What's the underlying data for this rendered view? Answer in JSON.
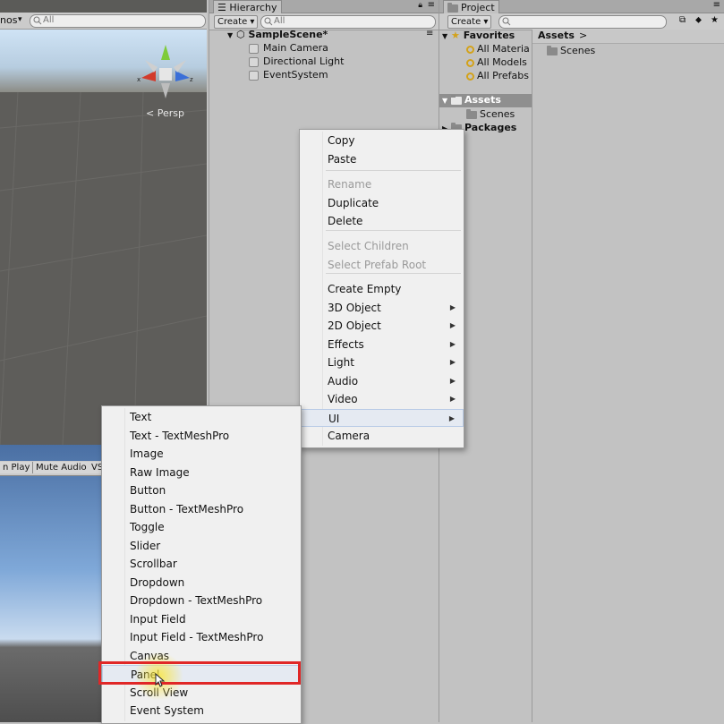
{
  "scene": {
    "gizmos_label": "nos",
    "search_placeholder": "All",
    "persp_label": "Persp",
    "axis_x": "x",
    "axis_z": "z"
  },
  "game": {
    "buttons": [
      "n Play",
      "Mute Audio",
      "VS"
    ]
  },
  "hierarchy": {
    "tab_label": "Hierarchy",
    "create_label": "Create",
    "search_placeholder": "All",
    "scene_name": "SampleScene*",
    "items": [
      "Main Camera",
      "Directional Light",
      "EventSystem"
    ]
  },
  "project": {
    "tab_label": "Project",
    "create_label": "Create",
    "favorites_label": "Favorites",
    "favorites": [
      "All Materia",
      "All Models",
      "All Prefabs"
    ],
    "assets_label": "Assets",
    "assets_children": [
      "Scenes"
    ],
    "packages_label": "Packages",
    "breadcrumb": "Assets",
    "content_items": [
      "Scenes"
    ]
  },
  "context_menu": {
    "group1": [
      "Copy",
      "Paste"
    ],
    "group2": [
      "Rename",
      "Duplicate",
      "Delete"
    ],
    "group3": [
      "Select Children",
      "Select Prefab Root"
    ],
    "group4": [
      "Create Empty",
      "3D Object",
      "2D Object",
      "Effects",
      "Light",
      "Audio",
      "Video",
      "UI",
      "Camera"
    ],
    "disabled": [
      "Rename",
      "Select Children",
      "Select Prefab Root"
    ],
    "submenu_items": [
      "3D Object",
      "2D Object",
      "Effects",
      "Light",
      "Audio",
      "Video",
      "UI"
    ],
    "highlighted": "UI"
  },
  "ui_submenu": {
    "items": [
      "Text",
      "Text - TextMeshPro",
      "Image",
      "Raw Image",
      "Button",
      "Button - TextMeshPro",
      "Toggle",
      "Slider",
      "Scrollbar",
      "Dropdown",
      "Dropdown - TextMeshPro",
      "Input Field",
      "Input Field - TextMeshPro",
      "Canvas",
      "Panel",
      "Scroll View",
      "Event System"
    ],
    "highlighted": "Panel"
  },
  "colors": {
    "highlight_box": "#e02727",
    "favorites_icon": "#d3a21a",
    "gizmo_y": "#7ecb3a",
    "gizmo_x": "#d23b2b",
    "gizmo_z": "#3a6fd8"
  }
}
